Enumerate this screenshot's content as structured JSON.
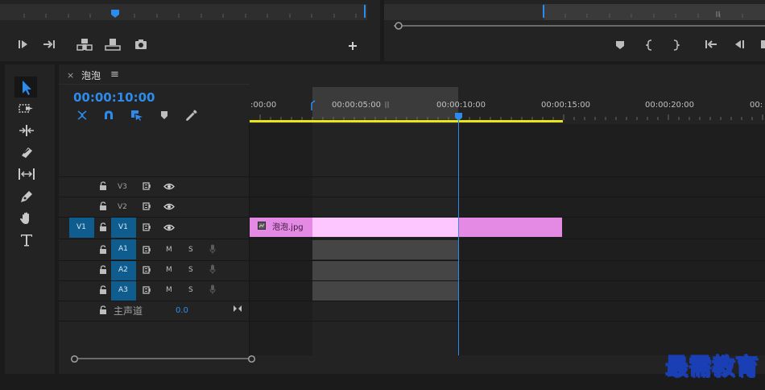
{
  "source_panel": {
    "buttons": [
      "mark-in",
      "go-to-out",
      "insert",
      "overwrite",
      "export-frame",
      "add"
    ]
  },
  "program_panel": {
    "buttons": [
      "add-marker",
      "mark-in",
      "mark-out",
      "go-to-in",
      "step-back"
    ]
  },
  "tools": [
    "selection-tool",
    "track-select-forward-tool",
    "ripple-edit-tool",
    "razor-tool",
    "slip-tool",
    "pen-tool",
    "hand-tool",
    "type-tool"
  ],
  "timeline": {
    "close_glyph": "×",
    "sequence_name": "泡泡",
    "menu_glyph": "≡",
    "timecode": "00:00:10:00",
    "ruler_labels": [
      ":00:00",
      "00:00:05:00",
      "00:00:10:00",
      "00:00:15:00",
      "00:00:20:00",
      "00:"
    ],
    "tracks": {
      "v3": {
        "label": "V3"
      },
      "v2": {
        "label": "V2"
      },
      "v1": {
        "source_label": "V1",
        "label": "V1"
      },
      "a1": {
        "label": "A1",
        "m": "M",
        "s": "S"
      },
      "a2": {
        "label": "A2",
        "m": "M",
        "s": "S"
      },
      "a3": {
        "label": "A3",
        "m": "M",
        "s": "S"
      },
      "master": {
        "label": "主声道",
        "value": "0.0"
      }
    },
    "clip": {
      "name": "泡泡.jpg",
      "color": "#e489e4",
      "selected_color": "#fec6fe"
    }
  },
  "colors": {
    "accent": "#2d8ceb",
    "track_active": "#0f5c8f",
    "work_area": "#e6e61a"
  },
  "watermark": "最需教育"
}
